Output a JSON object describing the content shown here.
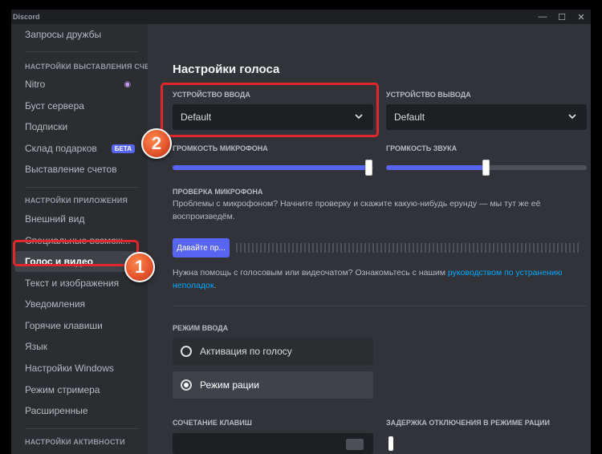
{
  "window": {
    "app_name": "Discord",
    "controls": {
      "minimize": "—",
      "maximize": "☐",
      "close": "✕"
    }
  },
  "sidebar": {
    "friend_requests": "Запросы дружбы",
    "billing_header": "НАСТРОЙКИ ВЫСТАВЛЕНИЯ СЧЕ",
    "billing_items": [
      {
        "label": "Nitro",
        "icon": "nitro-icon"
      },
      {
        "label": "Буст сервера"
      },
      {
        "label": "Подписки"
      },
      {
        "label": "Склад подарков",
        "badge": "БЕТА"
      },
      {
        "label": "Выставление счетов"
      }
    ],
    "app_header": "НАСТРОЙКИ ПРИЛОЖЕНИЯ",
    "app_items": [
      {
        "label": "Внешний вид"
      },
      {
        "label": "Специальные возмож..."
      },
      {
        "label": "Голос и видео",
        "active": true
      },
      {
        "label": "Текст и изображения"
      },
      {
        "label": "Уведомления"
      },
      {
        "label": "Горячие клавиши"
      },
      {
        "label": "Язык"
      },
      {
        "label": "Настройки Windows"
      },
      {
        "label": "Режим стримера"
      },
      {
        "label": "Расширенные"
      }
    ],
    "activity_header": "НАСТРОЙКИ АКТИВНОСТИ"
  },
  "main": {
    "title": "Настройки голоса",
    "input_device": {
      "label": "УСТРОЙСТВО ВВОДА",
      "value": "Default"
    },
    "output_device": {
      "label": "УСТРОЙСТВО ВЫВОДА",
      "value": "Default"
    },
    "mic_volume": {
      "label": "ГРОМКОСТЬ МИКРОФОНА",
      "level": 0.98
    },
    "output_volume": {
      "label": "ГРОМКОСТЬ ЗВУКА",
      "level": 0.5
    },
    "mic_test": {
      "label": "ПРОВЕРКА МИКРОФОНА",
      "description": "Проблемы с микрофоном? Начните проверку и скажите какую-нибудь ерунду — мы тут же её воспроизведём.",
      "button": "Давайте пр..."
    },
    "help": {
      "prefix": "Нужна помощь с голосовым или видеочатом? Ознакомьтесь с нашим ",
      "link": "руководством по устранению неполадок",
      "suffix": "."
    },
    "input_mode": {
      "label": "РЕЖИМ ВВОДА",
      "options": [
        {
          "label": "Активация по голосу",
          "selected": false
        },
        {
          "label": "Режим рации",
          "selected": true
        }
      ]
    },
    "shortcut_label": "СОЧЕТАНИЕ КЛАВИШ",
    "release_delay_label": "ЗАДЕРЖКА ОТКЛЮЧЕНИЯ В РЕЖИМЕ РАЦИИ"
  },
  "annotations": {
    "step1": "1",
    "step2": "2"
  },
  "colors": {
    "accent": "#5865f2",
    "annotation": "#e0272b",
    "link": "#00a8fc"
  }
}
